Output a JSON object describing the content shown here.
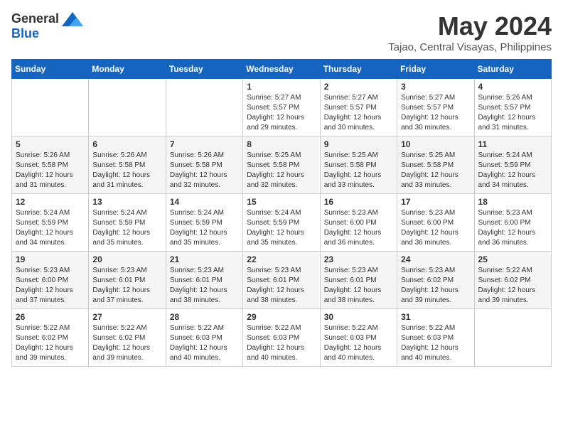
{
  "logo": {
    "general": "General",
    "blue": "Blue"
  },
  "title": "May 2024",
  "subtitle": "Tajao, Central Visayas, Philippines",
  "days_header": [
    "Sunday",
    "Monday",
    "Tuesday",
    "Wednesday",
    "Thursday",
    "Friday",
    "Saturday"
  ],
  "weeks": [
    [
      {
        "day": "",
        "info": ""
      },
      {
        "day": "",
        "info": ""
      },
      {
        "day": "",
        "info": ""
      },
      {
        "day": "1",
        "info": "Sunrise: 5:27 AM\nSunset: 5:57 PM\nDaylight: 12 hours\nand 29 minutes."
      },
      {
        "day": "2",
        "info": "Sunrise: 5:27 AM\nSunset: 5:57 PM\nDaylight: 12 hours\nand 30 minutes."
      },
      {
        "day": "3",
        "info": "Sunrise: 5:27 AM\nSunset: 5:57 PM\nDaylight: 12 hours\nand 30 minutes."
      },
      {
        "day": "4",
        "info": "Sunrise: 5:26 AM\nSunset: 5:57 PM\nDaylight: 12 hours\nand 31 minutes."
      }
    ],
    [
      {
        "day": "5",
        "info": "Sunrise: 5:26 AM\nSunset: 5:58 PM\nDaylight: 12 hours\nand 31 minutes."
      },
      {
        "day": "6",
        "info": "Sunrise: 5:26 AM\nSunset: 5:58 PM\nDaylight: 12 hours\nand 31 minutes."
      },
      {
        "day": "7",
        "info": "Sunrise: 5:26 AM\nSunset: 5:58 PM\nDaylight: 12 hours\nand 32 minutes."
      },
      {
        "day": "8",
        "info": "Sunrise: 5:25 AM\nSunset: 5:58 PM\nDaylight: 12 hours\nand 32 minutes."
      },
      {
        "day": "9",
        "info": "Sunrise: 5:25 AM\nSunset: 5:58 PM\nDaylight: 12 hours\nand 33 minutes."
      },
      {
        "day": "10",
        "info": "Sunrise: 5:25 AM\nSunset: 5:58 PM\nDaylight: 12 hours\nand 33 minutes."
      },
      {
        "day": "11",
        "info": "Sunrise: 5:24 AM\nSunset: 5:59 PM\nDaylight: 12 hours\nand 34 minutes."
      }
    ],
    [
      {
        "day": "12",
        "info": "Sunrise: 5:24 AM\nSunset: 5:59 PM\nDaylight: 12 hours\nand 34 minutes."
      },
      {
        "day": "13",
        "info": "Sunrise: 5:24 AM\nSunset: 5:59 PM\nDaylight: 12 hours\nand 35 minutes."
      },
      {
        "day": "14",
        "info": "Sunrise: 5:24 AM\nSunset: 5:59 PM\nDaylight: 12 hours\nand 35 minutes."
      },
      {
        "day": "15",
        "info": "Sunrise: 5:24 AM\nSunset: 5:59 PM\nDaylight: 12 hours\nand 35 minutes."
      },
      {
        "day": "16",
        "info": "Sunrise: 5:23 AM\nSunset: 6:00 PM\nDaylight: 12 hours\nand 36 minutes."
      },
      {
        "day": "17",
        "info": "Sunrise: 5:23 AM\nSunset: 6:00 PM\nDaylight: 12 hours\nand 36 minutes."
      },
      {
        "day": "18",
        "info": "Sunrise: 5:23 AM\nSunset: 6:00 PM\nDaylight: 12 hours\nand 36 minutes."
      }
    ],
    [
      {
        "day": "19",
        "info": "Sunrise: 5:23 AM\nSunset: 6:00 PM\nDaylight: 12 hours\nand 37 minutes."
      },
      {
        "day": "20",
        "info": "Sunrise: 5:23 AM\nSunset: 6:01 PM\nDaylight: 12 hours\nand 37 minutes."
      },
      {
        "day": "21",
        "info": "Sunrise: 5:23 AM\nSunset: 6:01 PM\nDaylight: 12 hours\nand 38 minutes."
      },
      {
        "day": "22",
        "info": "Sunrise: 5:23 AM\nSunset: 6:01 PM\nDaylight: 12 hours\nand 38 minutes."
      },
      {
        "day": "23",
        "info": "Sunrise: 5:23 AM\nSunset: 6:01 PM\nDaylight: 12 hours\nand 38 minutes."
      },
      {
        "day": "24",
        "info": "Sunrise: 5:23 AM\nSunset: 6:02 PM\nDaylight: 12 hours\nand 39 minutes."
      },
      {
        "day": "25",
        "info": "Sunrise: 5:22 AM\nSunset: 6:02 PM\nDaylight: 12 hours\nand 39 minutes."
      }
    ],
    [
      {
        "day": "26",
        "info": "Sunrise: 5:22 AM\nSunset: 6:02 PM\nDaylight: 12 hours\nand 39 minutes."
      },
      {
        "day": "27",
        "info": "Sunrise: 5:22 AM\nSunset: 6:02 PM\nDaylight: 12 hours\nand 39 minutes."
      },
      {
        "day": "28",
        "info": "Sunrise: 5:22 AM\nSunset: 6:03 PM\nDaylight: 12 hours\nand 40 minutes."
      },
      {
        "day": "29",
        "info": "Sunrise: 5:22 AM\nSunset: 6:03 PM\nDaylight: 12 hours\nand 40 minutes."
      },
      {
        "day": "30",
        "info": "Sunrise: 5:22 AM\nSunset: 6:03 PM\nDaylight: 12 hours\nand 40 minutes."
      },
      {
        "day": "31",
        "info": "Sunrise: 5:22 AM\nSunset: 6:03 PM\nDaylight: 12 hours\nand 40 minutes."
      },
      {
        "day": "",
        "info": ""
      }
    ]
  ]
}
